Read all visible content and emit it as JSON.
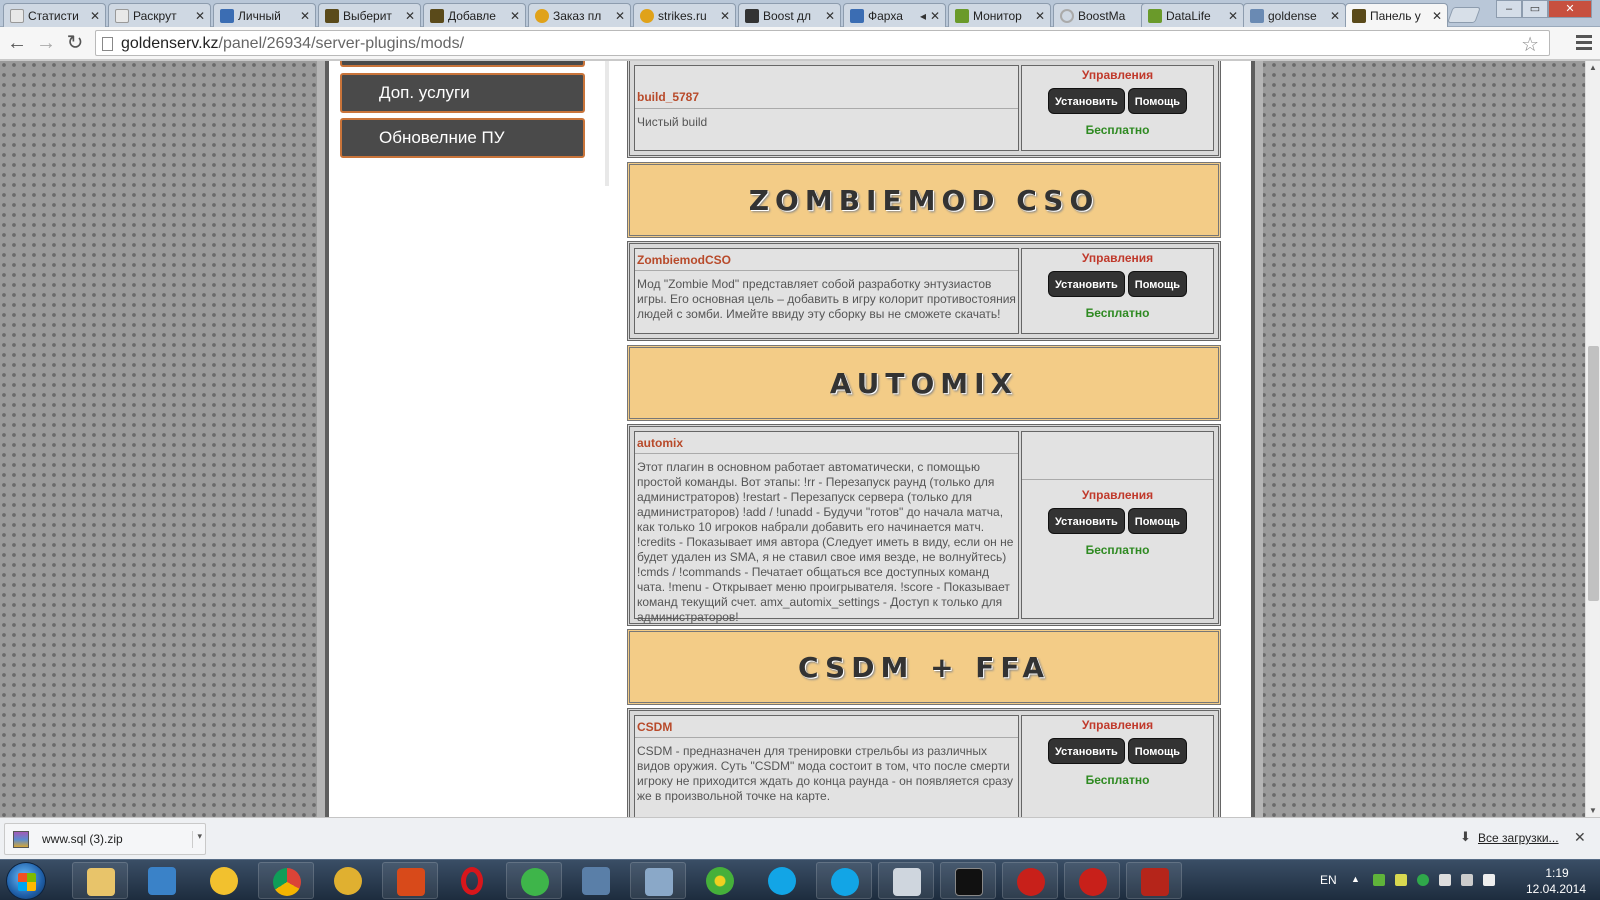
{
  "browser": {
    "tabs": [
      {
        "title": "Статисти",
        "color": "#e8e8e8"
      },
      {
        "title": "Раскрут",
        "color": "#e8e8e8"
      },
      {
        "title": "Личный",
        "color": "#3b6db3"
      },
      {
        "title": "Выберит",
        "color": "#5a4a1a"
      },
      {
        "title": "Добавле",
        "color": "#5a4a1a"
      },
      {
        "title": "Заказ пл",
        "color": "#e0a21a"
      },
      {
        "title": "strikes.ru",
        "color": "#e0a21a"
      },
      {
        "title": "Boost дл",
        "color": "#333333"
      },
      {
        "title": "Фарха",
        "color": "#3b6db3"
      },
      {
        "title": "Монитор",
        "color": "#6a9a2a"
      },
      {
        "title": "BoostMa",
        "color": "#cccccc"
      },
      {
        "title": "DataLife",
        "color": "#6a9a2a"
      },
      {
        "title": "goldense",
        "color": "#6a8ab3"
      },
      {
        "title": "Панель у",
        "color": "#5a4a1a"
      }
    ],
    "tab_close_glyph": "✕",
    "url_host": "goldenserv.kz",
    "url_path": "/panel/26934/server-plugins/mods/"
  },
  "sidebar": {
    "items": [
      {
        "label": "Доп. услуги"
      },
      {
        "label": "Обновелние ПУ"
      }
    ]
  },
  "control_labels": {
    "manage": "Управления",
    "install": "Установить",
    "help": "Помощь",
    "price": "Бесплатно"
  },
  "mods": [
    {
      "name": "build_5787",
      "description": "Чистый build"
    },
    {
      "banner": "ZOMBIEMOD CSO",
      "name": "ZombiemodCSO",
      "description": "Мод \"Zombie Mod\" представляет собой разработку энтузиастов игры. Его основная цель – добавить в игру колорит противостояния людей с зомби. Имейте ввиду эту сборку вы не сможете скачать!"
    },
    {
      "banner": "AUTOMIX",
      "name": "automix",
      "description": "Этот плагин в основном работает автоматически, с помощью простой команды. Вот этапы: !rr - Перезапуск раунд (только для администраторов) !restart - Перезапуск сервера (только для администраторов) !add / !unadd - Будучи \"готов\" до начала матча, как только 10 игроков набрали добавить его начинается матч. !credits - Показывает имя автора (Следует иметь в виду, если он не будет удален из SMA, я не ставил свое имя везде, не волнуйтесь) !cmds / !commands - Печатает общаться все доступных команд чата. !menu - Открывает меню проигрывателя. !score - Показывает команд текущий счет. amx_automix_settings - Доступ к только для администраторов!"
    },
    {
      "banner": "CSDM + FFA",
      "name": "CSDM",
      "description": "CSDM - предназначен для тренировки стрельбы из различных видов оружия. Суть \"CSDM\" мода состоит в том, что после смерти игроку не приходится ждать до конца раунда - он появляется сразу же в произвольной точке на карте."
    }
  ],
  "downloads": {
    "file": "www.sql (3).zip",
    "all_label": "Все загрузки..."
  },
  "taskbar": {
    "icons": [
      "explorer-icon",
      "media-player-icon",
      "messenger-icon",
      "chrome-icon",
      "agent-icon",
      "game-icon",
      "opera-icon",
      "mail-icon",
      "network-icon",
      "remote-icon",
      "icq-icon",
      "skype-icon",
      "skype-icon",
      "counter-strike-icon",
      "console-icon",
      "half-life-icon",
      "half-life-icon",
      "filezilla-icon"
    ],
    "language": "EN",
    "time": "1:19",
    "date": "12.04.2014"
  },
  "colors": {
    "banner": "#f3cc87",
    "mod_name": "#b84a2a",
    "manage_label": "#c0392b",
    "price": "#2f8a22",
    "button": "#333333"
  }
}
